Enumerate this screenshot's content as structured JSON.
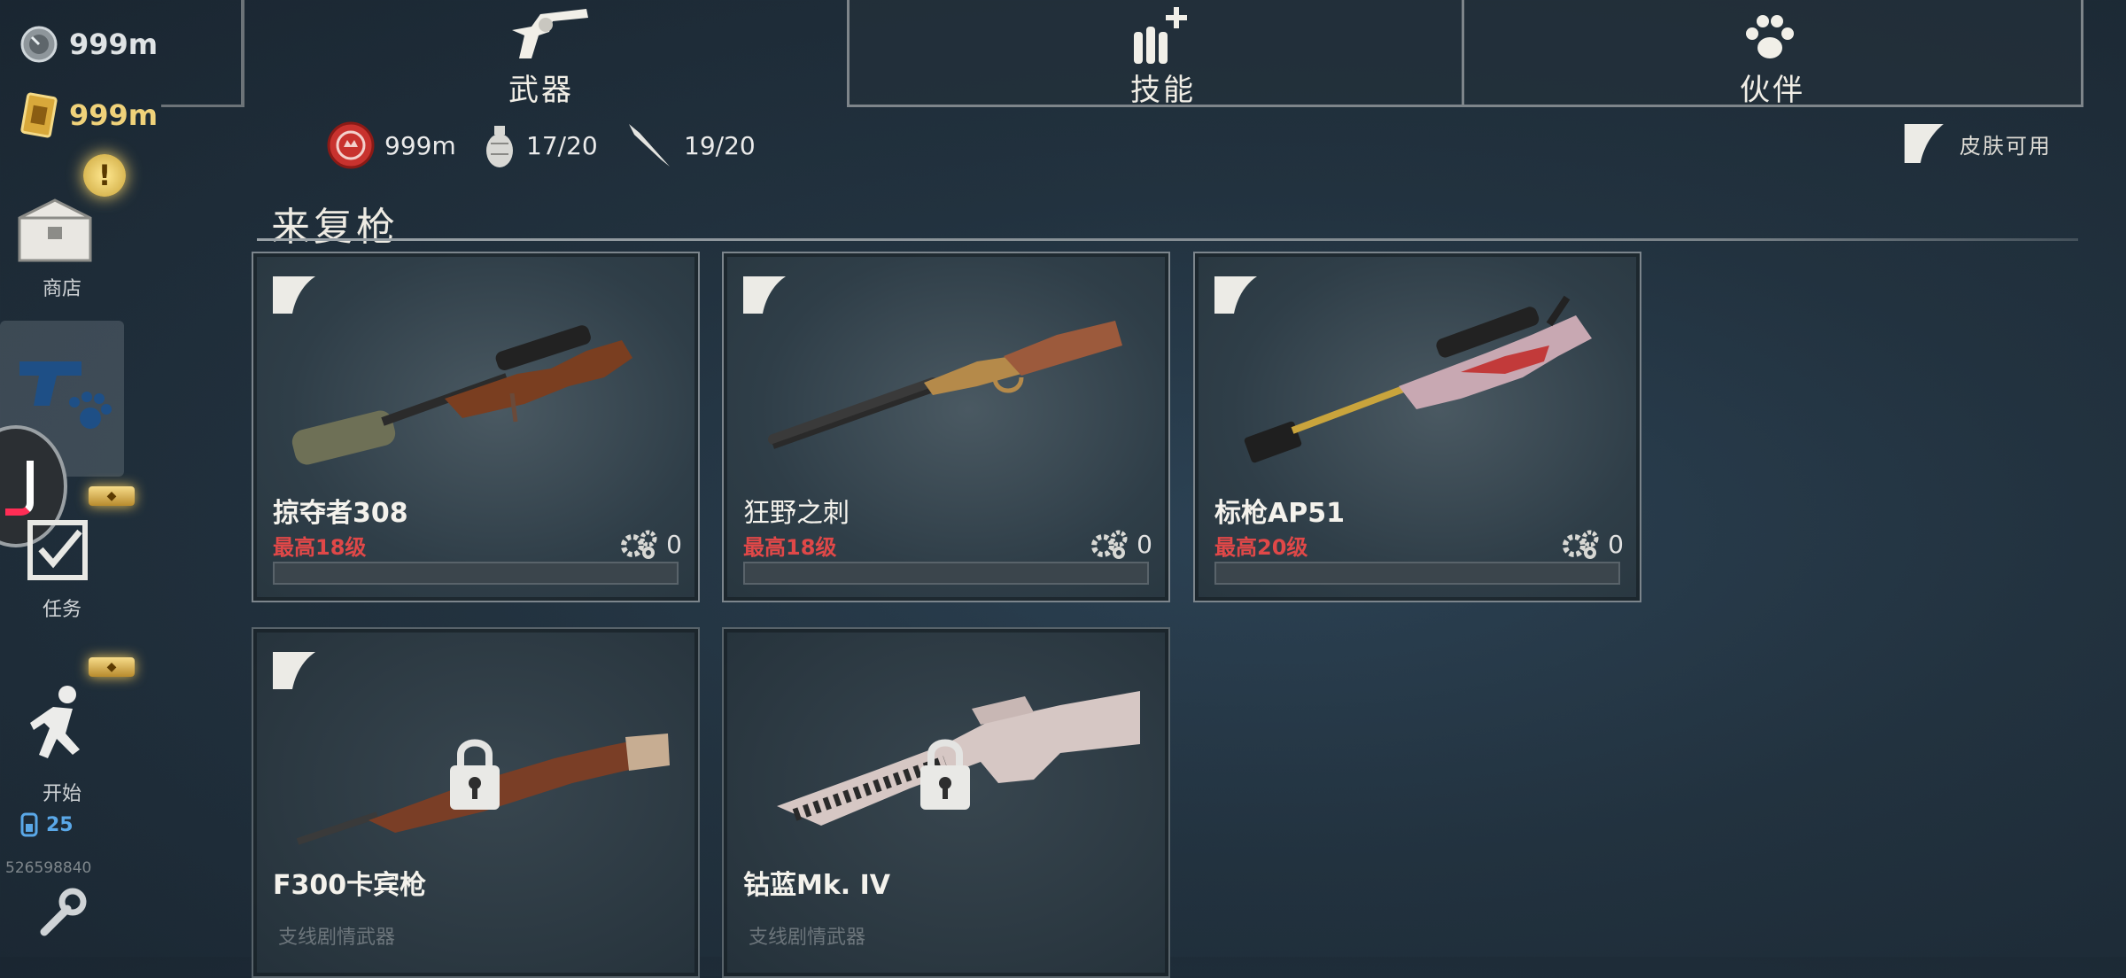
{
  "currencies": [
    {
      "icon": "silver-coin-icon",
      "value": "999m"
    },
    {
      "icon": "gold-bar-icon",
      "value": "999m"
    }
  ],
  "sidebar": {
    "shop_label": "商店",
    "tasks_label": "任务",
    "start_label": "开始",
    "energy_value": "25",
    "player_id": "526598840"
  },
  "tabs": [
    {
      "label": "武器",
      "icon": "revolver-icon",
      "active": true
    },
    {
      "label": "技能",
      "icon": "bullets-plus-icon",
      "active": false
    },
    {
      "label": "伙伴",
      "icon": "paw-icon",
      "active": false
    }
  ],
  "stats": [
    {
      "icon": "token-icon",
      "value": "999m"
    },
    {
      "icon": "grenade-icon",
      "value": "17/20"
    },
    {
      "icon": "knife-icon",
      "value": "19/20"
    }
  ],
  "skin_available_label": "皮肤可用",
  "section_title": "来复枪",
  "weapons": [
    {
      "name": "掠夺者308",
      "level": "最高18级",
      "gears": "0",
      "progress": 0,
      "locked": false
    },
    {
      "name": "狂野之刺",
      "level": "最高18级",
      "gears": "0",
      "progress": 0,
      "locked": false
    },
    {
      "name": "标枪AP51",
      "level": "最高20级",
      "gears": "0",
      "progress": 0,
      "locked": false
    },
    {
      "name": "F300卡宾枪",
      "subtitle": "支线剧情武器",
      "locked": true
    },
    {
      "name": "钴蓝Mk. IV",
      "subtitle": "支线剧情武器",
      "locked": true
    }
  ],
  "colors": {
    "level_red": "#e04848",
    "gold": "#f0d27a",
    "panel_border": "#7c858c"
  }
}
